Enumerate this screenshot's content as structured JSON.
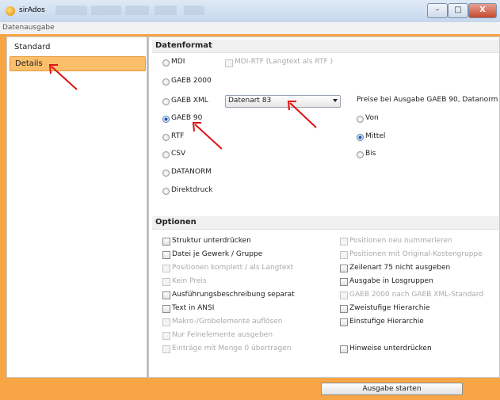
{
  "window": {
    "title": "sirAdos",
    "caption": "Datenausgabe"
  },
  "window_controls": {
    "minimize": "–",
    "maximize": "□",
    "close": "X"
  },
  "nav": {
    "items": [
      {
        "label": "Standard"
      },
      {
        "label": "Details"
      }
    ]
  },
  "datenformat": {
    "heading": "Datenformat",
    "formats": [
      {
        "label": "MDI",
        "selected": false
      },
      {
        "label": "GAEB 2000",
        "selected": false
      },
      {
        "label": "GAEB XML",
        "selected": false
      },
      {
        "label": "GAEB 90",
        "selected": true
      },
      {
        "label": "RTF",
        "selected": false
      },
      {
        "label": "CSV",
        "selected": false
      },
      {
        "label": "DATANORM",
        "selected": false
      },
      {
        "label": "Direktdruck",
        "selected": false
      }
    ],
    "mdi_rtf_label": "MDI-RTF (Langtext als RTF )",
    "dropdown_value": "Datenart 83",
    "preise_label": "Preise bei Ausgabe GAEB 90, Datanorm",
    "preise": [
      {
        "label": "Von",
        "selected": false
      },
      {
        "label": "Mittel",
        "selected": true
      },
      {
        "label": "Bis",
        "selected": false
      }
    ]
  },
  "optionen": {
    "heading": "Optionen",
    "left": [
      {
        "label": "Struktur unterdrücken",
        "enabled": true
      },
      {
        "label": "Datei je Gewerk / Gruppe",
        "enabled": true
      },
      {
        "label": "Positionen komplett / als Langtext",
        "enabled": false
      },
      {
        "label": "Kein Preis",
        "enabled": false
      },
      {
        "label": "Ausführungsbeschreibung separat",
        "enabled": true
      },
      {
        "label": "Text in ANSI",
        "enabled": true
      },
      {
        "label": "Makro-/Grobelemente auflösen",
        "enabled": false
      },
      {
        "label": "Nur Feinelemente ausgeben",
        "enabled": false
      },
      {
        "label": "Einträge mit Menge 0 übertragen",
        "enabled": false
      }
    ],
    "right": [
      {
        "label": "Positionen neu nummerieren",
        "enabled": false
      },
      {
        "label": "Positionen mit Original-Kostengruppe",
        "enabled": false
      },
      {
        "label": "Zeilenart 75 nicht ausgeben",
        "enabled": true
      },
      {
        "label": "Ausgabe in Losgruppen",
        "enabled": true
      },
      {
        "label": "GAEB 2000 nach GAEB XML-Standard",
        "enabled": false
      },
      {
        "label": "Zweistufige Hierarchie",
        "enabled": true
      },
      {
        "label": "Einstufige Hierarchie",
        "enabled": true
      },
      {
        "label": "Hinweise unterdrücken",
        "enabled": true
      }
    ]
  },
  "footer": {
    "start_label": "Ausgabe starten"
  },
  "colors": {
    "accent": "#f7a545",
    "selected_nav": "#fbbf6b",
    "annotation_arrow": "#e01010"
  }
}
